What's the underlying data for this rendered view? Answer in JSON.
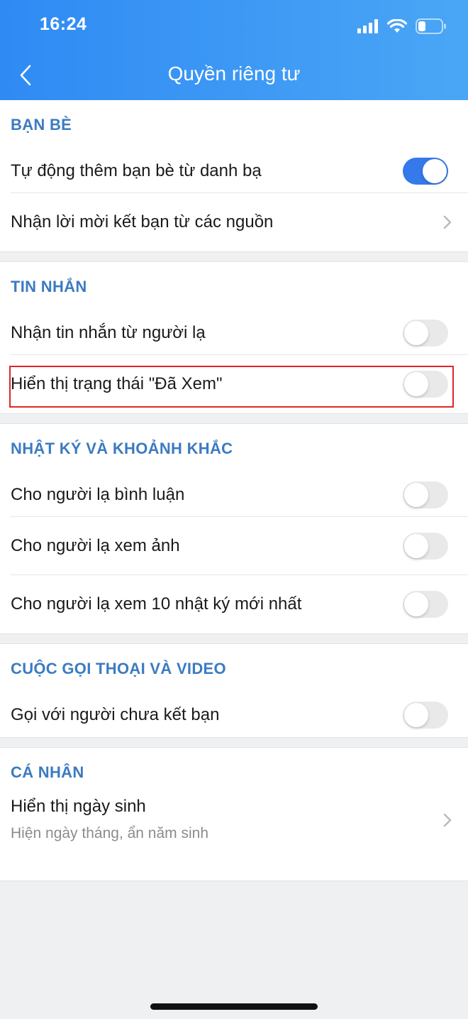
{
  "status_bar": {
    "time": "16:24",
    "icons": [
      "signal-icon",
      "wifi-icon",
      "battery-icon"
    ]
  },
  "nav": {
    "back_icon": "chevron-left-icon",
    "title": "Quyền riêng tư"
  },
  "colors": {
    "header_gradient_start": "#2f8af4",
    "header_gradient_end": "#4aa6f5",
    "section_title": "#3b7bc0",
    "toggle_on": "#3579ea",
    "toggle_off": "#e9e9ea",
    "highlight_border": "#e0262a"
  },
  "sections": [
    {
      "title": "BẠN BÈ",
      "rows": [
        {
          "label": "Tự động thêm bạn bè từ danh bạ",
          "control": "toggle",
          "on": true
        },
        {
          "label": "Nhận lời mời kết bạn từ các nguồn",
          "control": "chevron"
        }
      ]
    },
    {
      "title": "TIN NHẮN",
      "rows": [
        {
          "label": "Nhận tin nhắn từ người lạ",
          "control": "toggle",
          "on": false
        },
        {
          "label": "Hiển thị trạng thái \"Đã Xem\"",
          "control": "toggle",
          "on": false,
          "highlighted": true
        }
      ]
    },
    {
      "title": "NHẬT KÝ VÀ KHOẢNH KHẮC",
      "rows": [
        {
          "label": "Cho người lạ bình luận",
          "control": "toggle",
          "on": false
        },
        {
          "label": "Cho người lạ xem ảnh",
          "control": "toggle",
          "on": false
        },
        {
          "label": "Cho người lạ xem 10 nhật ký mới nhất",
          "control": "toggle",
          "on": false
        }
      ]
    },
    {
      "title": "CUỘC GỌI THOẠI VÀ VIDEO",
      "rows": [
        {
          "label": "Gọi với người chưa kết bạn",
          "control": "toggle",
          "on": false
        }
      ]
    },
    {
      "title": "CÁ NHÂN",
      "rows": [
        {
          "label": "Hiển thị ngày sinh",
          "sublabel": "Hiện ngày tháng, ẩn năm sinh",
          "control": "chevron"
        }
      ]
    }
  ]
}
